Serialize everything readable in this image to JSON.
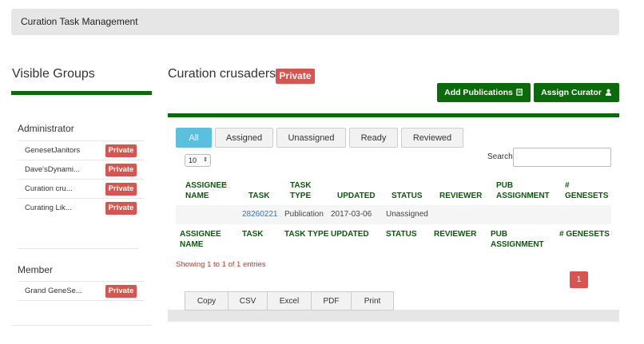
{
  "header": {
    "title": "Curation Task Management"
  },
  "sidebar": {
    "title": "Visible Groups",
    "sections": [
      {
        "heading": "Administrator",
        "items": [
          {
            "name": "GenesetJanitors",
            "badge": "Private"
          },
          {
            "name": "Dave'sDynami...",
            "badge": "Private"
          },
          {
            "name": "Curation cru...",
            "badge": "Private"
          },
          {
            "name": "Curating Lik...",
            "badge": "Private"
          }
        ]
      },
      {
        "heading": "Member",
        "items": [
          {
            "name": "Grand GeneSe...",
            "badge": "Private"
          }
        ]
      }
    ]
  },
  "main": {
    "group_title": "Curation crusaders",
    "group_badge": "Private",
    "buttons": {
      "add_publications": "Add Publications",
      "assign_curator": "Assign Curator"
    },
    "filters": [
      "All",
      "Assigned",
      "Unassigned",
      "Ready",
      "Reviewed"
    ],
    "active_filter": "All",
    "page_length": "10",
    "search_label": "Search:",
    "search_value": "",
    "columns_head": [
      "ASSIGNEE NAME",
      "TASK",
      "TASK TYPE",
      "UPDATED",
      "STATUS",
      "REVIEWER",
      "PUB ASSIGNMENT",
      "# GENESETS"
    ],
    "rows": [
      {
        "assignee": "",
        "task": "28260221",
        "task_type": "Publication",
        "updated": "2017-03-06",
        "status": "Unassigned",
        "reviewer": "",
        "pub_assignment": "",
        "genesets": ""
      }
    ],
    "columns_foot": [
      "ASSIGNEE NAME",
      "TASK",
      "TASK TYPE",
      "UPDATED",
      "STATUS",
      "REVIEWER",
      "PUB ASSIGNMENT",
      "# GENESETS"
    ],
    "showing": "Showing 1 to 1 of 1 entries",
    "current_page": "1",
    "export_buttons": [
      "Copy",
      "CSV",
      "Excel",
      "PDF",
      "Print"
    ]
  },
  "colors": {
    "brand_green": "#0b6b0b",
    "private_red": "#d9534f",
    "active_filter": "#5bc0de",
    "link_blue": "#3a6fb5"
  }
}
